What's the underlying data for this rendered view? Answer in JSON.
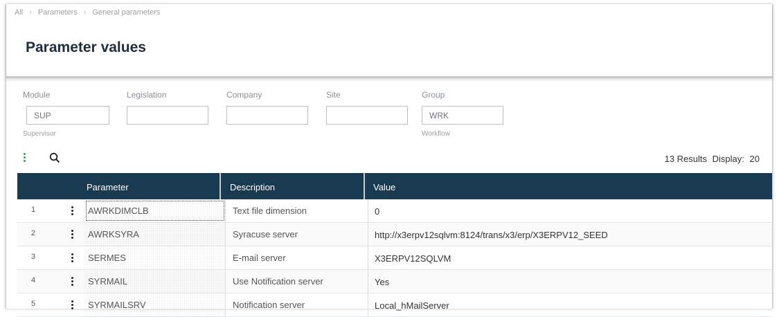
{
  "breadcrumb": [
    "All",
    "Parameters",
    "General parameters"
  ],
  "page": {
    "title": "Parameter values"
  },
  "filters": {
    "module": {
      "label": "Module",
      "value": "SUP",
      "sub": "Supervisor"
    },
    "legislation": {
      "label": "Legislation",
      "value": ""
    },
    "company": {
      "label": "Company",
      "value": ""
    },
    "site": {
      "label": "Site",
      "value": ""
    },
    "group": {
      "label": "Group",
      "value": "WRK",
      "sub": "Workflow"
    }
  },
  "toolbar": {
    "more_icon": "vertical-dots-icon",
    "search_icon": "search-icon"
  },
  "results": {
    "count_text": "13 Results",
    "display_label": "Display:",
    "display_value": "20"
  },
  "table": {
    "columns": [
      "Parameter",
      "Description",
      "Value"
    ],
    "rows": [
      {
        "num": "1",
        "parameter": "AWRKDIMCLB",
        "description": "Text file dimension",
        "value": "0"
      },
      {
        "num": "2",
        "parameter": "AWRKSYRA",
        "description": "Syracuse server",
        "value": "http://x3erpv12sqlvm:8124/trans/x3/erp/X3ERPV12_SEED"
      },
      {
        "num": "3",
        "parameter": "SERMES",
        "description": "E-mail server",
        "value": "X3ERPV12SQLVM"
      },
      {
        "num": "4",
        "parameter": "SYRMAIL",
        "description": "Use Notification server",
        "value": "Yes"
      },
      {
        "num": "5",
        "parameter": "SYRMAILSRV",
        "description": "Notification server",
        "value": "Local_hMailServer"
      }
    ]
  },
  "colors": {
    "header_bg": "#1a3a52",
    "accent_green": "#2e9c4f"
  }
}
